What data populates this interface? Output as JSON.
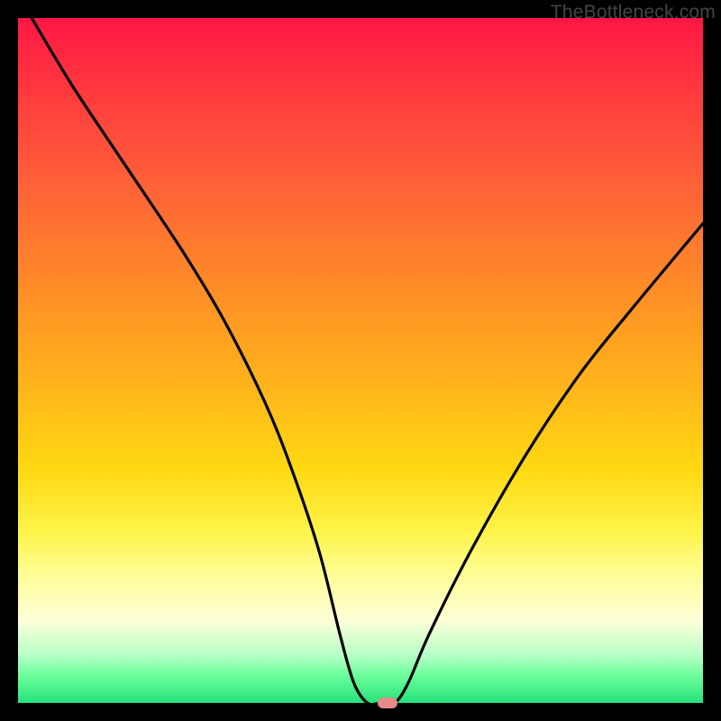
{
  "watermark": "TheBottleneck.com",
  "chart_data": {
    "type": "line",
    "title": "",
    "xlabel": "",
    "ylabel": "",
    "xlim": [
      0,
      100
    ],
    "ylim": [
      0,
      100
    ],
    "series": [
      {
        "name": "bottleneck-curve",
        "x": [
          2,
          8,
          16,
          24,
          30,
          36,
          40,
          44,
          47,
          49,
          51,
          53,
          55,
          57,
          60,
          66,
          74,
          82,
          90,
          100
        ],
        "y": [
          100,
          90,
          78,
          66,
          56,
          44,
          34,
          22,
          10,
          3,
          0,
          0,
          0,
          3,
          10,
          22,
          36,
          48,
          58,
          70
        ]
      }
    ],
    "marker": {
      "x": 54,
      "y": 0,
      "shape": "pill",
      "color": "#e88a8a"
    },
    "background_gradient": {
      "top": "#ff1744",
      "mid": "#ffd912",
      "bottom": "#26e07a"
    }
  }
}
